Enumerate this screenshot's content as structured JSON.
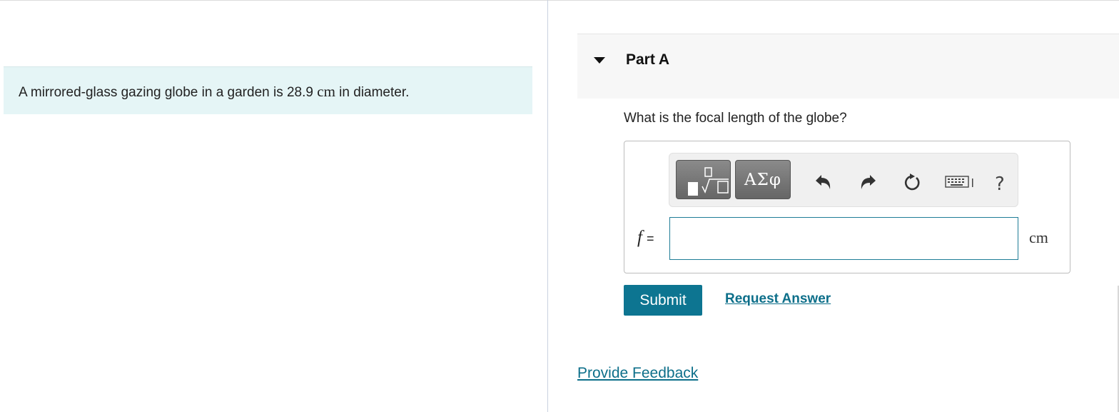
{
  "intro": {
    "before": "A mirrored-glass gazing globe in a garden is ",
    "value": "28.9",
    "unit": "cm",
    "after": " in diameter."
  },
  "part": {
    "title": "Part A",
    "question": "What is the focal length of the globe?"
  },
  "toolbar": {
    "templates_icon": "templates-fraction-root-icon",
    "symbols_label": "ΑΣφ",
    "undo_icon": "undo-icon",
    "redo_icon": "redo-icon",
    "reset_icon": "reset-icon",
    "keyboard_icon": "keyboard-icon",
    "help_label": "?"
  },
  "answer": {
    "variable": "f",
    "equals": "=",
    "value": "",
    "unit": "cm"
  },
  "actions": {
    "submit_label": "Submit",
    "request_label": "Request Answer",
    "feedback_label": "Provide Feedback"
  },
  "colors": {
    "intro_bg": "#e5f5f6",
    "accent": "#0d7591",
    "link": "#0d6f8a"
  }
}
